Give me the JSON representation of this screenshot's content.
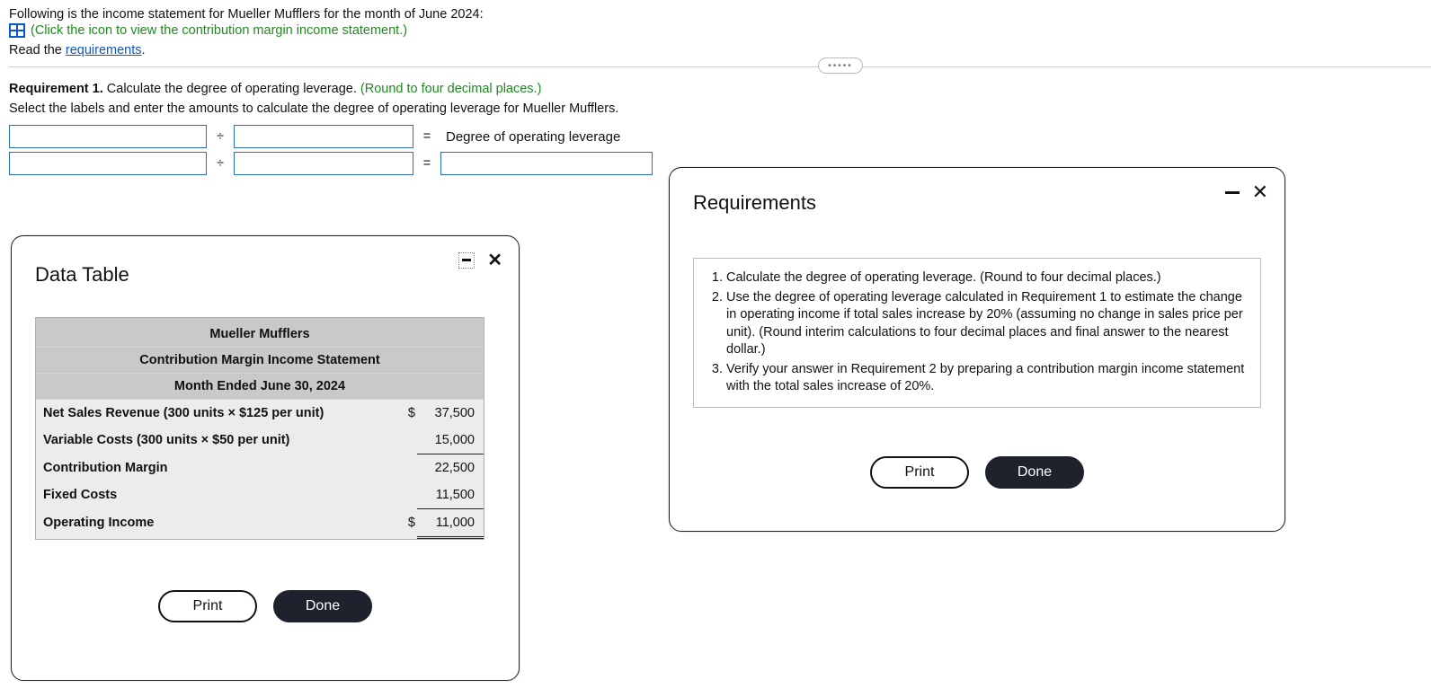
{
  "intro": "Following is the income statement for Mueller Mufflers for the month of June 2024:",
  "icon_link_text": "(Click the icon to view the contribution margin income statement.)",
  "read_prefix": "Read the ",
  "read_link": "requirements",
  "read_period": ".",
  "grip_dots": "•••••",
  "requirement1": {
    "label": "Requirement 1.",
    "text": " Calculate the degree of operating leverage. ",
    "note": "(Round to four decimal places.)"
  },
  "select_instruction": "Select the labels and enter the amounts to calculate the degree of operating leverage for Mueller Mufflers.",
  "ops": {
    "divide": "÷",
    "equals": "="
  },
  "leverage_label": "Degree of operating leverage",
  "data_table_modal": {
    "title": "Data Table",
    "header1": "Mueller Mufflers",
    "header2": "Contribution Margin Income Statement",
    "header3": "Month Ended June 30, 2024",
    "rows": {
      "net_sales_label": "Net Sales Revenue (300 units × $125 per unit)",
      "net_sales_dollar": "$",
      "net_sales_amount": "37,500",
      "var_costs_label": "Variable Costs (300 units × $50 per unit)",
      "var_costs_amount": "15,000",
      "cm_label": "Contribution Margin",
      "cm_amount": "22,500",
      "fixed_label": "Fixed Costs",
      "fixed_amount": "11,500",
      "op_income_label": "Operating Income",
      "op_income_dollar": "$",
      "op_income_amount": "11,000"
    },
    "print": "Print",
    "done": "Done"
  },
  "req_modal": {
    "title": "Requirements",
    "items": [
      "Calculate the degree of operating leverage. (Round to four decimal places.)",
      "Use the degree of operating leverage calculated in Requirement 1 to estimate the change in operating income if total sales increase by 20% (assuming no change in sales price per unit). (Round interim calculations to four decimal places and final answer to the nearest dollar.)",
      "Verify your answer in Requirement 2 by preparing a contribution margin income statement with the total sales increase of 20%."
    ],
    "print": "Print",
    "done": "Done"
  },
  "chart_data": {
    "type": "table",
    "title": "Mueller Mufflers — Contribution Margin Income Statement — Month Ended June 30, 2024",
    "rows": [
      {
        "label": "Net Sales Revenue (300 units × $125 per unit)",
        "value": 37500
      },
      {
        "label": "Variable Costs (300 units × $50 per unit)",
        "value": 15000
      },
      {
        "label": "Contribution Margin",
        "value": 22500
      },
      {
        "label": "Fixed Costs",
        "value": 11500
      },
      {
        "label": "Operating Income",
        "value": 11000
      }
    ]
  }
}
